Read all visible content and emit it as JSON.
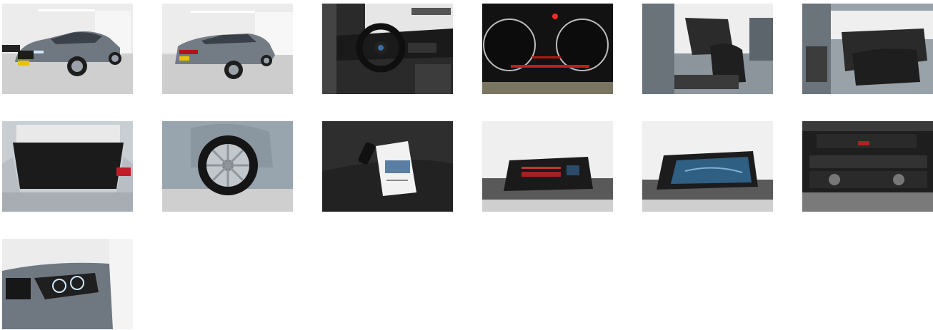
{
  "gallery": {
    "thumbnails": [
      {
        "subject": "car-front-left-exterior"
      },
      {
        "subject": "car-rear-left-exterior"
      },
      {
        "subject": "steering-wheel-dashboard"
      },
      {
        "subject": "instrument-cluster"
      },
      {
        "subject": "front-door-open-driver-seat"
      },
      {
        "subject": "rear-door-open-back-seat"
      },
      {
        "subject": "open-trunk"
      },
      {
        "subject": "wheel-alloy-rim"
      },
      {
        "subject": "keys-and-manual-on-seat"
      },
      {
        "subject": "infotainment-screen-menu"
      },
      {
        "subject": "infotainment-screen-map"
      },
      {
        "subject": "center-console-climate-controls"
      },
      {
        "subject": "headlight-front-detail"
      }
    ]
  }
}
